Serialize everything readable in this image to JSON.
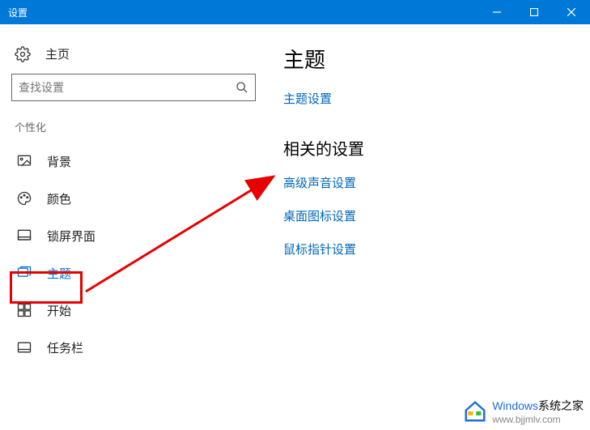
{
  "titlebar": {
    "title": "设置"
  },
  "sidebar": {
    "home_label": "主页",
    "search_placeholder": "查找设置",
    "section_label": "个性化",
    "items": [
      {
        "label": "背景"
      },
      {
        "label": "颜色"
      },
      {
        "label": "锁屏界面"
      },
      {
        "label": "主题"
      },
      {
        "label": "开始"
      },
      {
        "label": "任务栏"
      }
    ]
  },
  "main": {
    "heading": "主题",
    "theme_settings_link": "主题设置",
    "related_heading": "相关的设置",
    "related_links": [
      "高级声音设置",
      "桌面图标设置",
      "鼠标指针设置"
    ]
  },
  "watermark": {
    "brand": "Windows",
    "suffix": "系统之家",
    "url": "www.bjjmlv.com"
  }
}
